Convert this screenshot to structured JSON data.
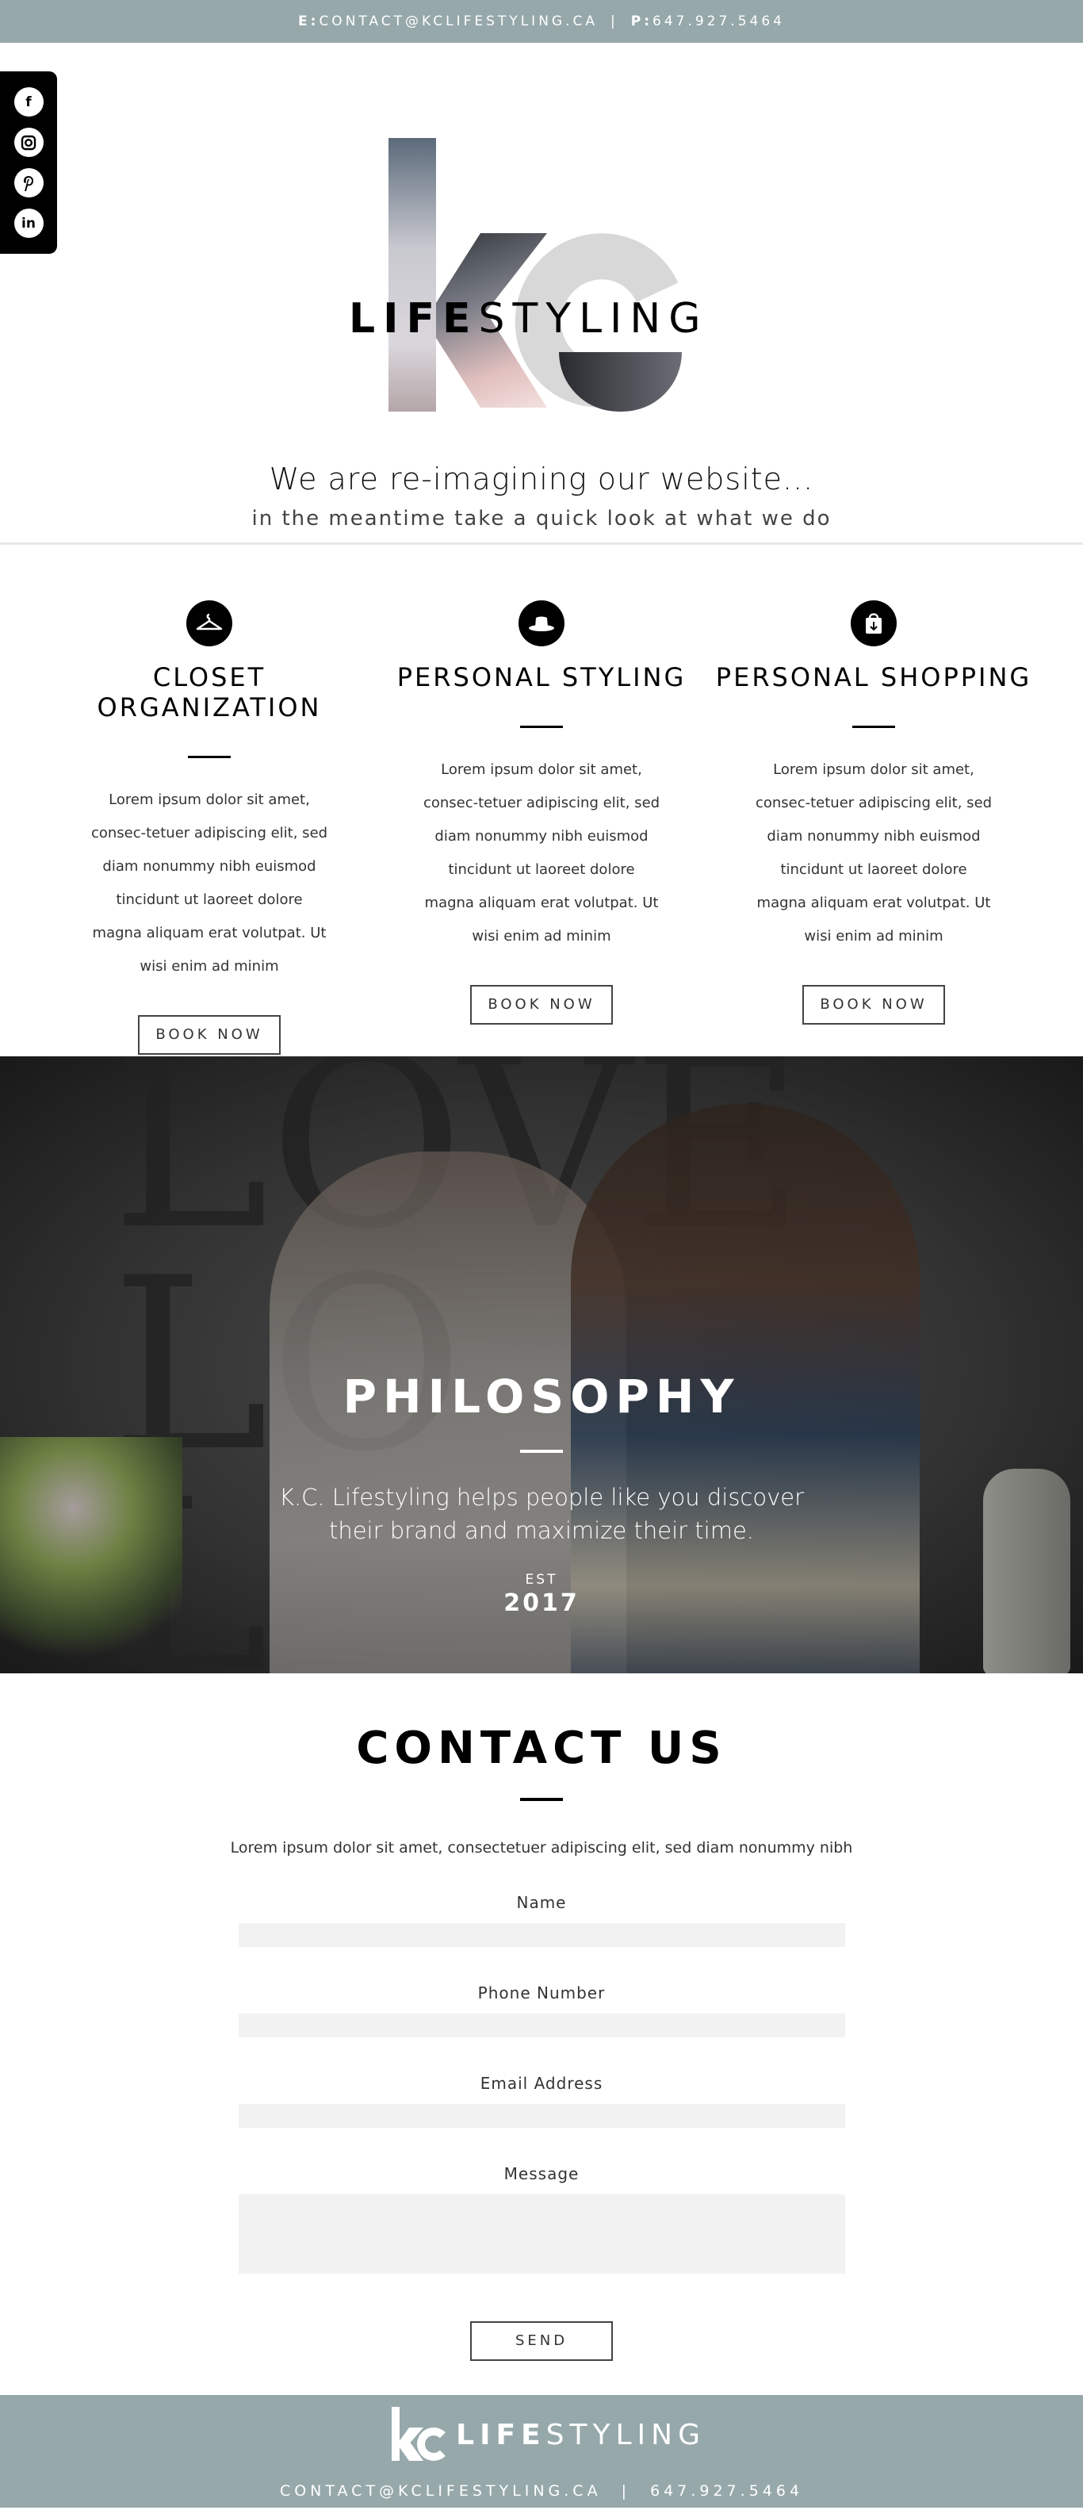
{
  "topbar": {
    "email_prefix": "E:",
    "email": "CONTACT@KCLIFESTYLING.CA",
    "separator": "|",
    "phone_prefix": "P:",
    "phone": "647.927.5464"
  },
  "social": {
    "icons": [
      "facebook-icon",
      "instagram-icon",
      "pinterest-icon",
      "linkedin-icon"
    ],
    "glyphs": [
      "f",
      "◘",
      "p",
      "in"
    ]
  },
  "hero": {
    "logo_bold": "LIFE",
    "logo_light": "STYLING",
    "tagline": "We are re-imagining our website...",
    "subtagline": "in the meantime take a quick look at what we do"
  },
  "services": [
    {
      "icon": "hanger-icon",
      "title": "CLOSET ORGANIZATION",
      "text": "Lorem ipsum dolor sit amet, consec-tetuer adipiscing elit, sed diam nonummy nibh euismod tincidunt ut laoreet dolore magna aliquam erat volutpat. Ut wisi enim ad minim",
      "button": "BOOK NOW"
    },
    {
      "icon": "hat-icon",
      "title": "PERSONAL STYLING",
      "text": "Lorem ipsum dolor sit amet, consec-tetuer adipiscing elit, sed diam nonummy nibh euismod tincidunt ut laoreet dolore magna aliquam erat volutpat. Ut wisi enim ad minim",
      "button": "BOOK NOW"
    },
    {
      "icon": "shopping-bag-icon",
      "title": "PERSONAL SHOPPING",
      "text": "Lorem ipsum dolor sit amet, consec-tetuer adipiscing elit, sed diam nonummy nibh euismod tincidunt ut laoreet dolore magna aliquam erat volutpat. Ut wisi enim ad minim",
      "button": "BOOK NOW"
    }
  ],
  "philosophy": {
    "background_word": "LOVE LO L",
    "title": "PHILOSOPHY",
    "text_line1": "K.C. Lifestyling helps people like you discover",
    "text_line2": "their brand and maximize their time.",
    "est_label": "EST",
    "year": "2017"
  },
  "contact": {
    "title": "CONTACT US",
    "intro": "Lorem ipsum dolor sit amet, consectetuer adipiscing elit, sed diam nonummy nibh",
    "fields": {
      "name_label": "Name",
      "phone_label": "Phone Number",
      "email_label": "Email Address",
      "message_label": "Message"
    },
    "send": "SEND"
  },
  "footer": {
    "logo_bold": "LIFE",
    "logo_light": "STYLING",
    "email": "CONTACT@KCLIFESTYLING.CA",
    "separator": "|",
    "phone": "647.927.5464"
  },
  "colors": {
    "accent": "#97a8ab",
    "text": "#111111",
    "field_bg": "#f2f2f3"
  }
}
